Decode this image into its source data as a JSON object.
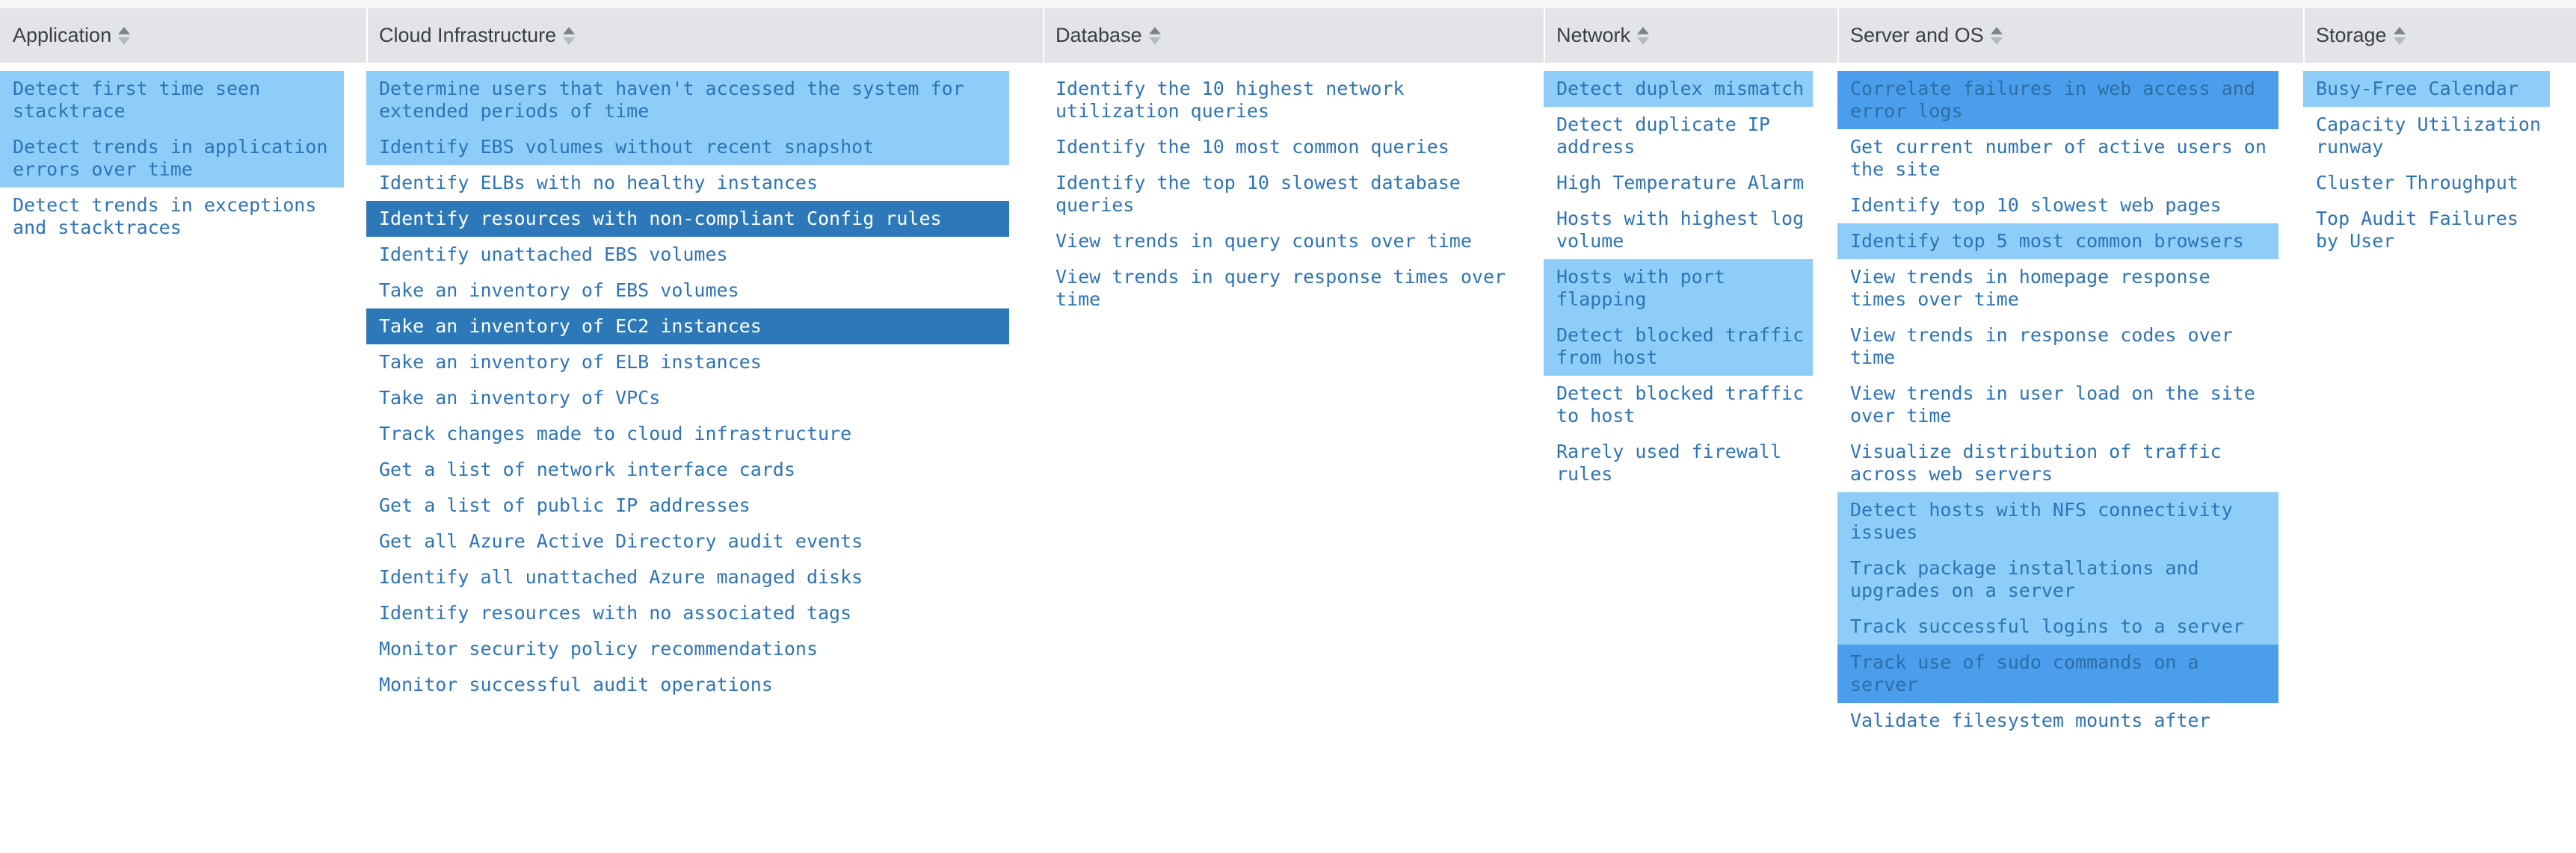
{
  "meta": {
    "accent_light": "#8dcdf7",
    "accent_mid": "#4a9eec",
    "accent_dark": "#2d78b8",
    "text_link": "#2e74b5",
    "header_bg": "#e2e4e8",
    "header_text": "#3b3f45"
  },
  "sort_icon": "sort-updown-icon",
  "columns": [
    {
      "id": "application",
      "title": "Application",
      "items": [
        {
          "label": "Detect first time seen stacktrace",
          "highlight": "light"
        },
        {
          "label": "Detect trends in application errors over time",
          "highlight": "light"
        },
        {
          "label": "Detect trends in exceptions and stacktraces",
          "highlight": "none"
        }
      ]
    },
    {
      "id": "cloud-infrastructure",
      "title": "Cloud Infrastructure",
      "items": [
        {
          "label": "Determine users that haven't accessed the system for extended periods of time",
          "highlight": "light"
        },
        {
          "label": "Identify EBS volumes without recent snapshot",
          "highlight": "light"
        },
        {
          "label": "Identify ELBs with no healthy instances",
          "highlight": "none"
        },
        {
          "label": "Identify resources with non-compliant Config rules",
          "highlight": "dark"
        },
        {
          "label": "Identify unattached EBS volumes",
          "highlight": "none"
        },
        {
          "label": "Take an inventory of EBS volumes",
          "highlight": "none"
        },
        {
          "label": "Take an inventory of EC2 instances",
          "highlight": "dark"
        },
        {
          "label": "Take an inventory of ELB instances",
          "highlight": "none"
        },
        {
          "label": "Take an inventory of VPCs",
          "highlight": "none"
        },
        {
          "label": "Track changes made to cloud infrastructure",
          "highlight": "none"
        },
        {
          "label": "Get a list of network interface cards",
          "highlight": "none"
        },
        {
          "label": "Get a list of public IP addresses",
          "highlight": "none"
        },
        {
          "label": "Get all Azure Active Directory audit events",
          "highlight": "none"
        },
        {
          "label": "Identify all unattached Azure managed disks",
          "highlight": "none"
        },
        {
          "label": "Identify resources with no associated tags",
          "highlight": "none"
        },
        {
          "label": "Monitor security policy recommendations",
          "highlight": "none"
        },
        {
          "label": "Monitor successful audit operations",
          "highlight": "none"
        }
      ]
    },
    {
      "id": "database",
      "title": "Database",
      "items": [
        {
          "label": "Identify the 10 highest network utilization queries",
          "highlight": "none"
        },
        {
          "label": "Identify the 10 most common queries",
          "highlight": "none"
        },
        {
          "label": "Identify the top 10 slowest database queries",
          "highlight": "none"
        },
        {
          "label": "View trends in query counts over time",
          "highlight": "none"
        },
        {
          "label": "View trends in query response times over time",
          "highlight": "none"
        }
      ]
    },
    {
      "id": "network",
      "title": "Network",
      "items": [
        {
          "label": "Detect duplex mismatch",
          "highlight": "light"
        },
        {
          "label": "Detect duplicate IP address",
          "highlight": "none"
        },
        {
          "label": "High Temperature Alarm",
          "highlight": "none"
        },
        {
          "label": "Hosts with highest log volume",
          "highlight": "none"
        },
        {
          "label": "Hosts with port flapping",
          "highlight": "light"
        },
        {
          "label": "Detect blocked traffic from host",
          "highlight": "light"
        },
        {
          "label": "Detect blocked traffic to host",
          "highlight": "none"
        },
        {
          "label": "Rarely used firewall rules",
          "highlight": "none"
        }
      ]
    },
    {
      "id": "server-and-os",
      "title": "Server and OS",
      "items": [
        {
          "label": "Correlate failures in web access and error logs",
          "highlight": "mid"
        },
        {
          "label": "Get current number of active users on the site",
          "highlight": "none"
        },
        {
          "label": "Identify top 10 slowest web pages",
          "highlight": "none"
        },
        {
          "label": "Identify top 5 most common browsers",
          "highlight": "light"
        },
        {
          "label": "View trends in homepage response times over time",
          "highlight": "none"
        },
        {
          "label": "View trends in response codes over time",
          "highlight": "none"
        },
        {
          "label": "View trends in user load on the site over time",
          "highlight": "none"
        },
        {
          "label": "Visualize distribution of traffic across web servers",
          "highlight": "none"
        },
        {
          "label": "Detect hosts with NFS connectivity issues",
          "highlight": "light"
        },
        {
          "label": "Track package installations and upgrades on a server",
          "highlight": "light"
        },
        {
          "label": "Track successful logins to a server",
          "highlight": "light"
        },
        {
          "label": "Track use of sudo commands on a server",
          "highlight": "mid"
        },
        {
          "label": "Validate filesystem mounts after",
          "highlight": "none"
        }
      ]
    },
    {
      "id": "storage",
      "title": "Storage",
      "items": [
        {
          "label": "Busy-Free Calendar",
          "highlight": "light"
        },
        {
          "label": "Capacity Utilization runway",
          "highlight": "none"
        },
        {
          "label": "Cluster Throughput",
          "highlight": "none"
        },
        {
          "label": "Top Audit Failures by User",
          "highlight": "none"
        }
      ]
    }
  ]
}
